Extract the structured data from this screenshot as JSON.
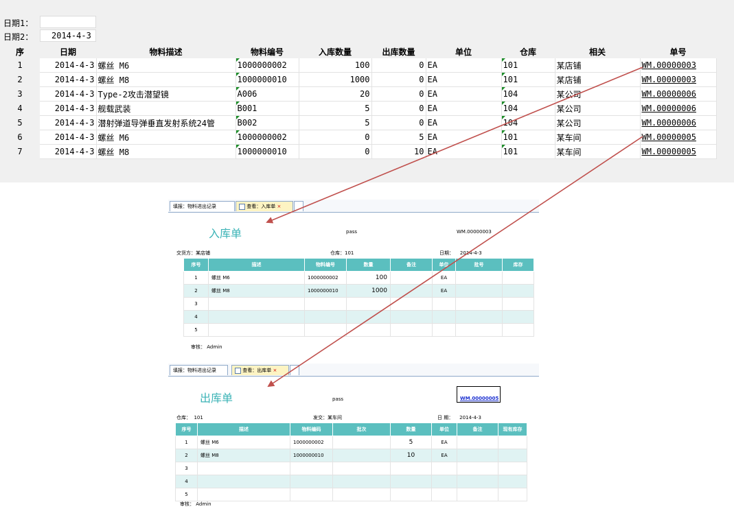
{
  "filters": {
    "date1_label": "日期1：",
    "date1_value": "",
    "date2_label": "日期2：",
    "date2_value": "2014-4-3"
  },
  "table": {
    "headers": [
      "序",
      "日期",
      "物料描述",
      "物料编号",
      "入库数量",
      "出库数量",
      "单位",
      "仓库",
      "相关",
      "单号"
    ],
    "rows": [
      {
        "seq": "1",
        "date": "2014-4-3",
        "desc": "螺丝 M6",
        "code": "1000000002",
        "in": "100",
        "out": "0",
        "unit": "EA",
        "wh": "101",
        "rel": "某店铺",
        "no": "WM.00000003"
      },
      {
        "seq": "2",
        "date": "2014-4-3",
        "desc": "螺丝 M8",
        "code": "1000000010",
        "in": "1000",
        "out": "0",
        "unit": "EA",
        "wh": "101",
        "rel": "某店铺",
        "no": "WM.00000003"
      },
      {
        "seq": "3",
        "date": "2014-4-3",
        "desc": "Type-2攻击潜望镜",
        "code": "A006",
        "in": "20",
        "out": "0",
        "unit": "EA",
        "wh": "104",
        "rel": "某公司",
        "no": "WM.00000006"
      },
      {
        "seq": "4",
        "date": "2014-4-3",
        "desc": "舰载武装",
        "code": "B001",
        "in": "5",
        "out": "0",
        "unit": "EA",
        "wh": "104",
        "rel": "某公司",
        "no": "WM.00000006"
      },
      {
        "seq": "5",
        "date": "2014-4-3",
        "desc": "潜射弹道导弹垂直发射系统24管",
        "code": "B002",
        "in": "5",
        "out": "0",
        "unit": "EA",
        "wh": "104",
        "rel": "某公司",
        "no": "WM.00000006"
      },
      {
        "seq": "6",
        "date": "2014-4-3",
        "desc": "螺丝 M6",
        "code": "1000000002",
        "in": "0",
        "out": "5",
        "unit": "EA",
        "wh": "101",
        "rel": "某车间",
        "no": "WM.00000005"
      },
      {
        "seq": "7",
        "date": "2014-4-3",
        "desc": "螺丝 M8",
        "code": "1000000010",
        "in": "0",
        "out": "10",
        "unit": "EA",
        "wh": "101",
        "rel": "某车间",
        "no": "WM.00000005"
      }
    ]
  },
  "inbound": {
    "tab1": "填报：物料进出记录",
    "tab2": "查看：入库单",
    "tab_close": "×",
    "title": "入库单",
    "pass": "pass",
    "doc_no": "WM.00000003",
    "party_label": "交货方：",
    "party_value": "某店铺",
    "wh_label": "仓库：",
    "wh_value": "101",
    "date_label": "日期：",
    "date_value": "2014-4-3",
    "headers": [
      "序号",
      "描述",
      "物料编号",
      "数量",
      "备注",
      "单位",
      "批号",
      "库存"
    ],
    "rows": [
      {
        "seq": "1",
        "desc": "螺丝 M6",
        "code": "1000000002",
        "qty": "100",
        "note": "",
        "unit": "EA",
        "batch": "",
        "stock": ""
      },
      {
        "seq": "2",
        "desc": "螺丝 M8",
        "code": "1000000010",
        "qty": "1000",
        "note": "",
        "unit": "EA",
        "batch": "",
        "stock": ""
      },
      {
        "seq": "3",
        "desc": "",
        "code": "",
        "qty": "",
        "note": "",
        "unit": "",
        "batch": "",
        "stock": ""
      },
      {
        "seq": "4",
        "desc": "",
        "code": "",
        "qty": "",
        "note": "",
        "unit": "",
        "batch": "",
        "stock": ""
      },
      {
        "seq": "5",
        "desc": "",
        "code": "",
        "qty": "",
        "note": "",
        "unit": "",
        "batch": "",
        "stock": ""
      }
    ],
    "approver": "审核： Admin"
  },
  "outbound": {
    "tab1": "填报：物料进出记录",
    "tab2": "查看：出库单",
    "tab_close": "×",
    "title": "出库单",
    "pass": "pass",
    "doc_no": "WM.00000005",
    "wh_label": "仓库：",
    "wh_value": "101",
    "party_label": "发交：",
    "party_value": "某车间",
    "date_label": "日  期：",
    "date_value": "2014-4-3",
    "headers": [
      "序号",
      "描述",
      "物料编码",
      "批次",
      "数量",
      "单位",
      "备注",
      "现有库存"
    ],
    "rows": [
      {
        "seq": "1",
        "desc": "螺丝 M6",
        "code": "1000000002",
        "batch": "",
        "qty": "5",
        "unit": "EA",
        "note": "",
        "stock": ""
      },
      {
        "seq": "2",
        "desc": "螺丝 M8",
        "code": "1000000010",
        "batch": "",
        "qty": "10",
        "unit": "EA",
        "note": "",
        "stock": ""
      },
      {
        "seq": "3",
        "desc": "",
        "code": "",
        "batch": "",
        "qty": "",
        "unit": "",
        "note": "",
        "stock": ""
      },
      {
        "seq": "4",
        "desc": "",
        "code": "",
        "batch": "",
        "qty": "",
        "unit": "",
        "note": "",
        "stock": ""
      },
      {
        "seq": "5",
        "desc": "",
        "code": "",
        "batch": "",
        "qty": "",
        "unit": "",
        "note": "",
        "stock": ""
      }
    ],
    "approver": "审核： Admin"
  },
  "colors": {
    "arrow": "#c0504d",
    "header_teal": "#5bbfbf",
    "title_teal": "#3bb3b6",
    "alt_row": "#e0f3f3",
    "marker": "#1e8e2a"
  }
}
